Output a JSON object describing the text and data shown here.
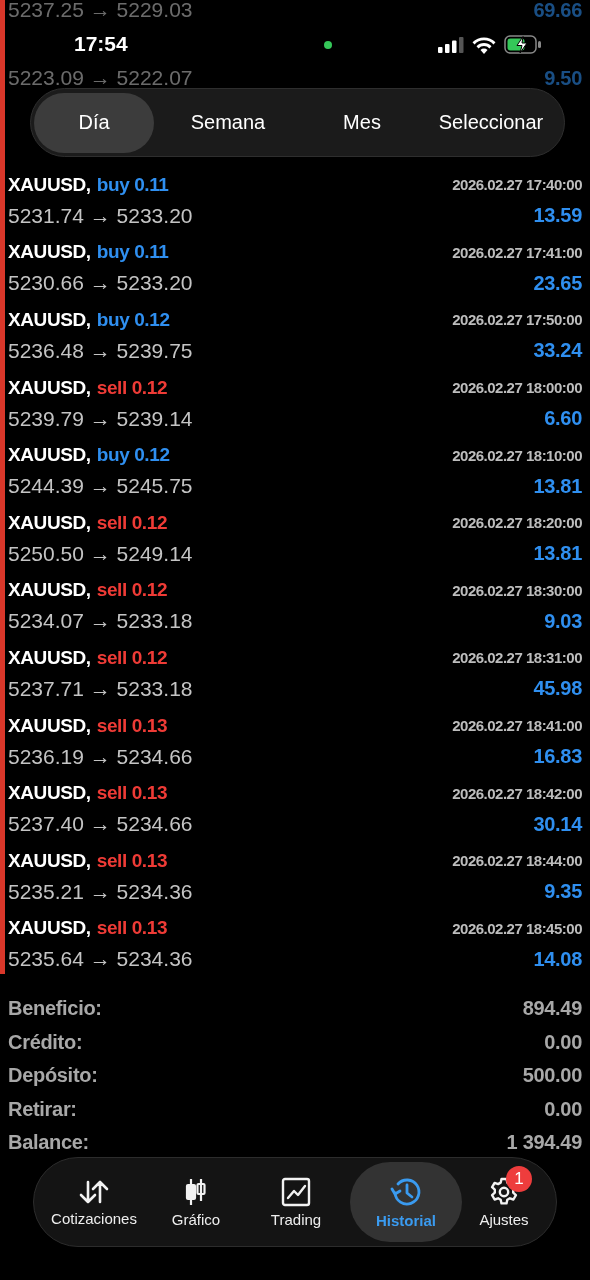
{
  "status_bar": {
    "time": "17:54"
  },
  "period_tabs": [
    {
      "label": "Día",
      "selected": true
    },
    {
      "label": "Semana",
      "selected": false
    },
    {
      "label": "Mes",
      "selected": false
    },
    {
      "label": "Seleccionar",
      "selected": false
    }
  ],
  "faded_rows": [
    {
      "prices": "5237.25 → 5229.03",
      "profit": "69.66"
    },
    {
      "prices": "5223.09 → 5222.07",
      "profit": "9.50"
    }
  ],
  "trades": [
    {
      "symbol": "XAUUSD,",
      "side": "buy",
      "volume": "0.11",
      "time": "2026.02.27 17:40:00",
      "prices": "5231.74 → 5233.20",
      "profit": "13.59"
    },
    {
      "symbol": "XAUUSD,",
      "side": "buy",
      "volume": "0.11",
      "time": "2026.02.27 17:41:00",
      "prices": "5230.66 → 5233.20",
      "profit": "23.65"
    },
    {
      "symbol": "XAUUSD,",
      "side": "buy",
      "volume": "0.12",
      "time": "2026.02.27 17:50:00",
      "prices": "5236.48 → 5239.75",
      "profit": "33.24"
    },
    {
      "symbol": "XAUUSD,",
      "side": "sell",
      "volume": "0.12",
      "time": "2026.02.27 18:00:00",
      "prices": "5239.79 → 5239.14",
      "profit": "6.60"
    },
    {
      "symbol": "XAUUSD,",
      "side": "buy",
      "volume": "0.12",
      "time": "2026.02.27 18:10:00",
      "prices": "5244.39 → 5245.75",
      "profit": "13.81"
    },
    {
      "symbol": "XAUUSD,",
      "side": "sell",
      "volume": "0.12",
      "time": "2026.02.27 18:20:00",
      "prices": "5250.50 → 5249.14",
      "profit": "13.81"
    },
    {
      "symbol": "XAUUSD,",
      "side": "sell",
      "volume": "0.12",
      "time": "2026.02.27 18:30:00",
      "prices": "5234.07 → 5233.18",
      "profit": "9.03"
    },
    {
      "symbol": "XAUUSD,",
      "side": "sell",
      "volume": "0.12",
      "time": "2026.02.27 18:31:00",
      "prices": "5237.71 → 5233.18",
      "profit": "45.98"
    },
    {
      "symbol": "XAUUSD,",
      "side": "sell",
      "volume": "0.13",
      "time": "2026.02.27 18:41:00",
      "prices": "5236.19 → 5234.66",
      "profit": "16.83"
    },
    {
      "symbol": "XAUUSD,",
      "side": "sell",
      "volume": "0.13",
      "time": "2026.02.27 18:42:00",
      "prices": "5237.40 → 5234.66",
      "profit": "30.14"
    },
    {
      "symbol": "XAUUSD,",
      "side": "sell",
      "volume": "0.13",
      "time": "2026.02.27 18:44:00",
      "prices": "5235.21 → 5234.36",
      "profit": "9.35"
    },
    {
      "symbol": "XAUUSD,",
      "side": "sell",
      "volume": "0.13",
      "time": "2026.02.27 18:45:00",
      "prices": "5235.64 → 5234.36",
      "profit": "14.08"
    }
  ],
  "summary": [
    {
      "label": "Beneficio:",
      "value": "894.49"
    },
    {
      "label": "Crédito:",
      "value": "0.00"
    },
    {
      "label": "Depósito:",
      "value": "500.00"
    },
    {
      "label": "Retirar:",
      "value": "0.00"
    },
    {
      "label": "Balance:",
      "value": "1 394.49"
    }
  ],
  "tab_bar": [
    {
      "label": "Cotizaciones",
      "selected": false
    },
    {
      "label": "Gráfico",
      "selected": false
    },
    {
      "label": "Trading",
      "selected": false
    },
    {
      "label": "Historial",
      "selected": true
    },
    {
      "label": "Ajustes",
      "selected": false,
      "badge": "1"
    }
  ]
}
